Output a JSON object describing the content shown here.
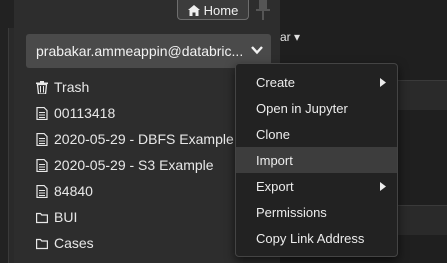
{
  "header": {
    "home_label": "Home",
    "home_icon": "home-icon",
    "pin_icon": "pin-icon"
  },
  "account": {
    "email": "prabakar.ammeappin@databric...",
    "chevron_icon": "chevron-down-icon"
  },
  "files": [
    {
      "label": "Trash",
      "icon": "trash-icon"
    },
    {
      "label": "00113418",
      "icon": "document-icon"
    },
    {
      "label": "2020-05-29 - DBFS Example",
      "icon": "document-icon"
    },
    {
      "label": "2020-05-29 - S3 Example",
      "icon": "document-icon"
    },
    {
      "label": "84840",
      "icon": "document-icon"
    },
    {
      "label": "BUI",
      "icon": "folder-icon"
    },
    {
      "label": "Cases",
      "icon": "folder-icon"
    }
  ],
  "right_fragment": "ar ▾",
  "context_menu": {
    "items": [
      {
        "label": "Create",
        "has_submenu": true
      },
      {
        "label": "Open in Jupyter",
        "has_submenu": false
      },
      {
        "label": "Clone",
        "has_submenu": false
      },
      {
        "label": "Import",
        "has_submenu": false,
        "highlighted": true
      },
      {
        "label": "Export",
        "has_submenu": true
      },
      {
        "label": "Permissions",
        "has_submenu": false
      },
      {
        "label": "Copy Link Address",
        "has_submenu": false
      }
    ]
  },
  "colors": {
    "panel_bg": "#2d2d2d",
    "menu_bg": "#222222",
    "menu_highlight": "#3d3d3d",
    "account_bg": "#4a4a4a"
  }
}
